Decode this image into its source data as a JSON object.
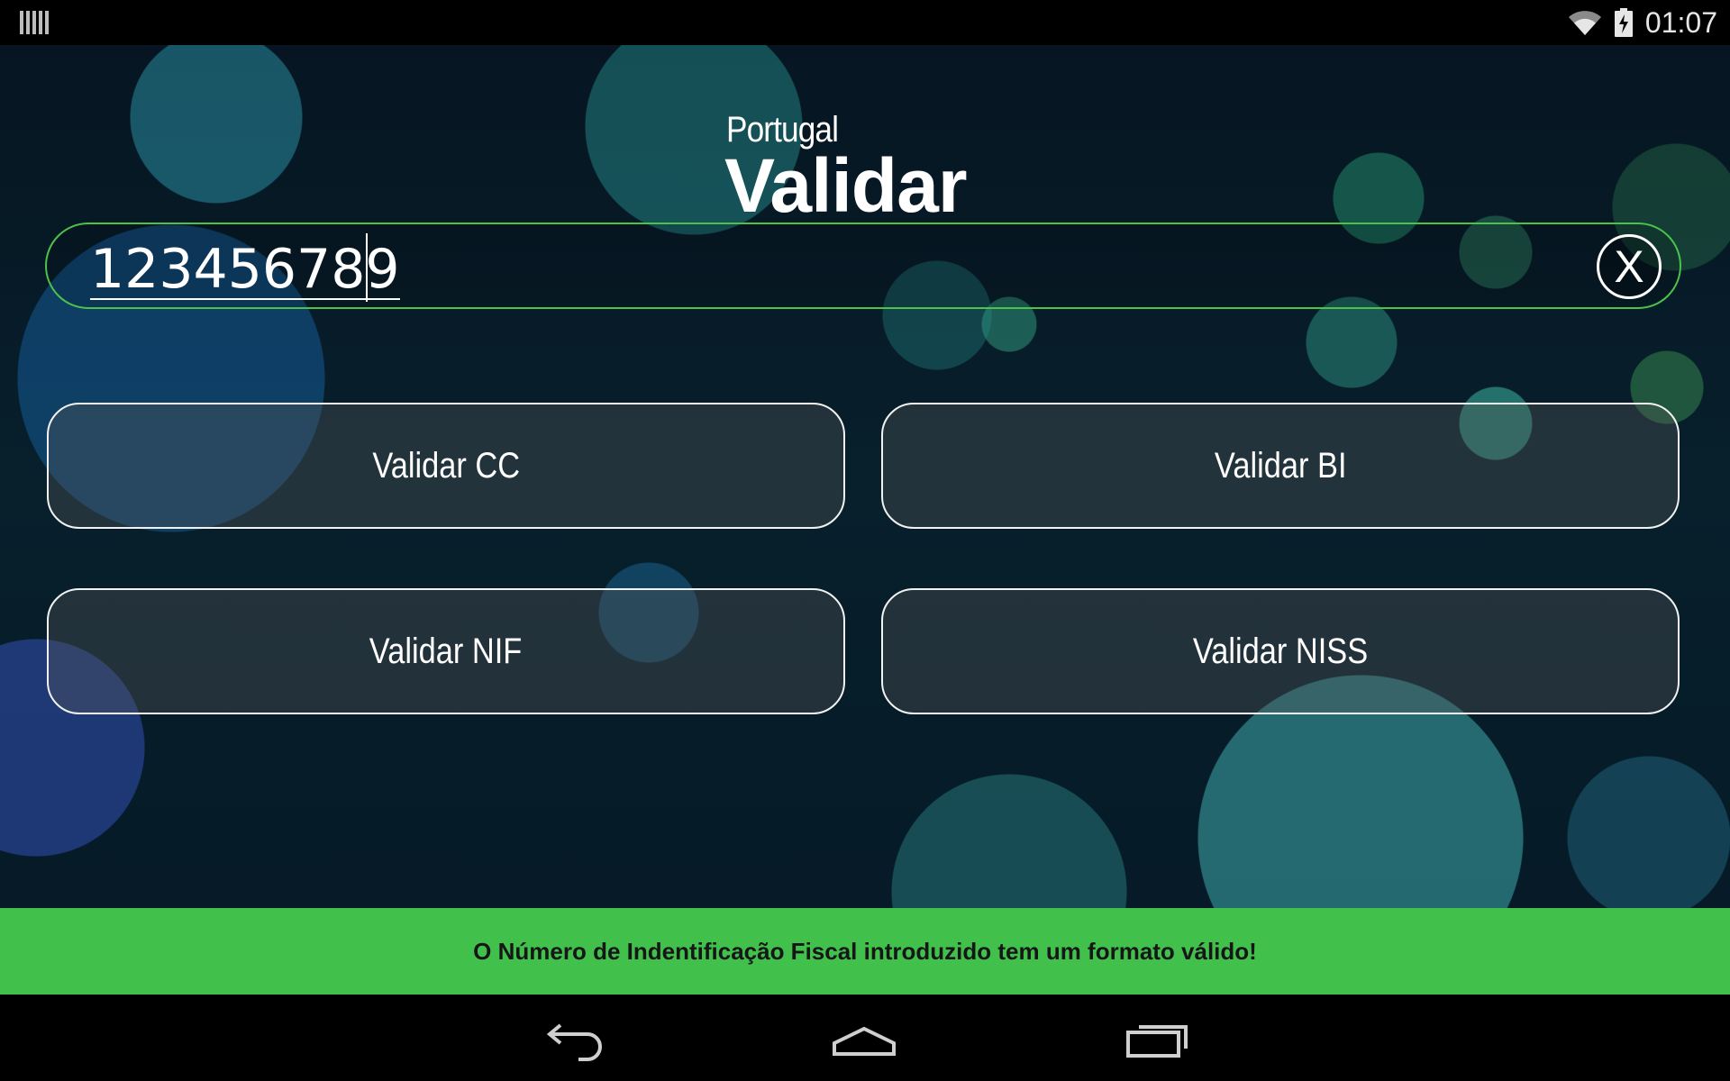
{
  "status_bar": {
    "time": "01:07",
    "icons": [
      "barcode-notification-icon",
      "wifi-icon",
      "battery-charging-icon"
    ]
  },
  "logo": {
    "subtitle": "Portugal",
    "title": "Validar"
  },
  "input": {
    "value": "123456789",
    "clear_label": "X"
  },
  "buttons": {
    "cc": "Validar CC",
    "bi": "Validar BI",
    "nif": "Validar NIF",
    "niss": "Validar NISS"
  },
  "toast": {
    "message": "O Número de Indentificação Fiscal introduzido tem um formato válido!"
  },
  "nav_bar": {
    "icons": [
      "back-icon",
      "home-icon",
      "recents-icon"
    ]
  },
  "colors": {
    "accent_green": "#41c14c",
    "input_border": "#4cc24a"
  }
}
